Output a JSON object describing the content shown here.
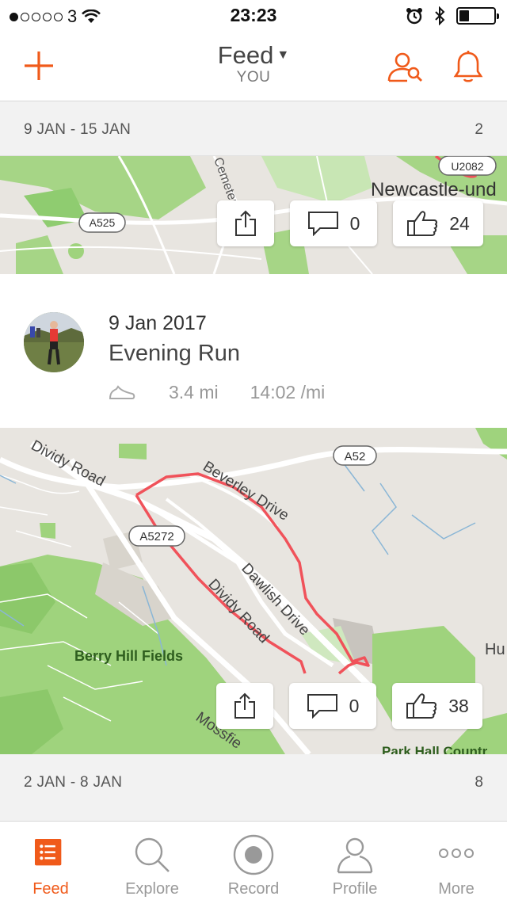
{
  "status_bar": {
    "carrier": "3",
    "time": "23:23"
  },
  "nav": {
    "title": "Feed",
    "subtitle": "YOU"
  },
  "colors": {
    "accent": "#f05a1a",
    "map_green": "#9fd37d",
    "route": "#f0525a"
  },
  "weeks": [
    {
      "range": "9 JAN - 15 JAN",
      "count": "2"
    },
    {
      "range": "2 JAN - 8 JAN",
      "count": "8"
    }
  ],
  "map1": {
    "labels": {
      "road_a525": "A525",
      "road_u2082": "U2082",
      "town": "Newcastle-und",
      "street": "Cemetery"
    },
    "comments": "0",
    "kudos": "24"
  },
  "activity": {
    "date": "9 Jan 2017",
    "name": "Evening Run",
    "distance": "3.4 mi",
    "pace": "14:02 /mi"
  },
  "map2": {
    "labels": {
      "a52": "A52",
      "a5272": "A5272",
      "dividy_road_1": "Dividy Road",
      "beverley_drive": "Beverley Drive",
      "dawlish_drive": "Dawlish Drive",
      "dividy_road_2": "Dividy Road",
      "berry_hill": "Berry Hill Fields",
      "mossfield": "Mossfie",
      "park_hall": "Park Hall Countr",
      "hu": "Hu"
    },
    "comments": "0",
    "kudos": "38"
  },
  "tabs": [
    {
      "label": "Feed",
      "icon": "feed-icon",
      "active": true
    },
    {
      "label": "Explore",
      "icon": "search-icon"
    },
    {
      "label": "Record",
      "icon": "record-icon"
    },
    {
      "label": "Profile",
      "icon": "profile-icon"
    },
    {
      "label": "More",
      "icon": "more-icon"
    }
  ]
}
